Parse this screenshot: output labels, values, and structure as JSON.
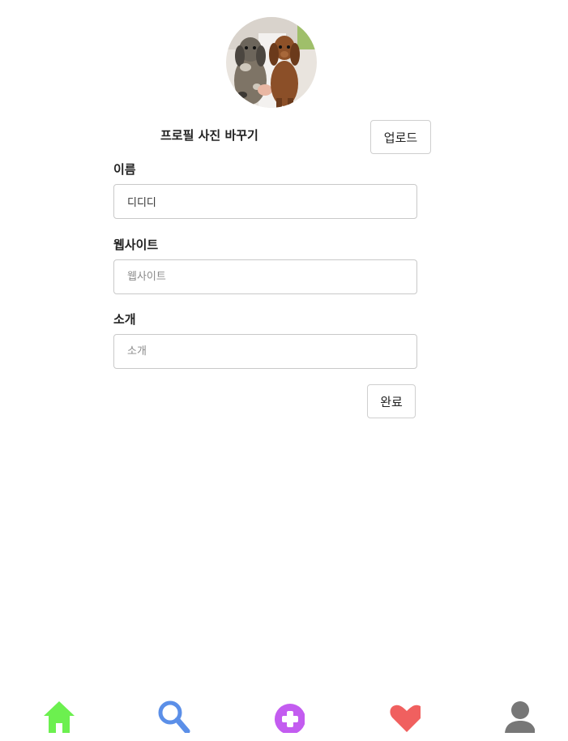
{
  "profile": {
    "avatar_alt": "two dachshund puppies",
    "change_photo_label": "프로필 사진 바꾸기",
    "upload_label": "업로드"
  },
  "form": {
    "name": {
      "label": "이름",
      "value": "디디디",
      "placeholder": ""
    },
    "website": {
      "label": "웹사이트",
      "value": "",
      "placeholder": "웹사이트"
    },
    "bio": {
      "label": "소개",
      "value": "",
      "placeholder": "소개"
    },
    "submit_label": "완료"
  },
  "bottom_nav": {
    "items": [
      {
        "name": "home",
        "icon": "home-icon",
        "color": "#6cf04f"
      },
      {
        "name": "search",
        "icon": "search-icon",
        "color": "#5b8fe8"
      },
      {
        "name": "add",
        "icon": "plus-circle-icon",
        "color": "#c35cf0"
      },
      {
        "name": "likes",
        "icon": "heart-icon",
        "color": "#f0605f"
      },
      {
        "name": "profile",
        "icon": "user-icon",
        "color": "#777777"
      }
    ]
  }
}
